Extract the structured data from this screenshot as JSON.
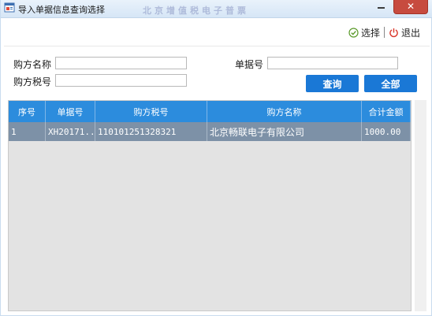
{
  "window": {
    "title": "导入单据信息查询选择",
    "watermark": "北京增值税电子普票",
    "close_glyph": "✕"
  },
  "toolbar": {
    "select_label": "选择",
    "exit_label": "退出"
  },
  "form": {
    "buyer_name_label": "购方名称",
    "buyer_tax_label": "购方税号",
    "doc_no_label": "单据号",
    "buyer_name_value": "",
    "buyer_tax_value": "",
    "doc_no_value": "",
    "query_label": "查询",
    "all_label": "全部"
  },
  "table": {
    "headers": [
      "序号",
      "单据号",
      "购方税号",
      "购方名称",
      "合计金额"
    ],
    "rows": [
      [
        "1",
        "XH20171...",
        "110101251328321",
        "北京畅联电子有限公司",
        "1000.00"
      ]
    ]
  },
  "colors": {
    "accent": "#1a78d6",
    "header_bg": "#2c8cdd",
    "selected_row": "#7d91a7",
    "close_red": "#c74b3f"
  }
}
